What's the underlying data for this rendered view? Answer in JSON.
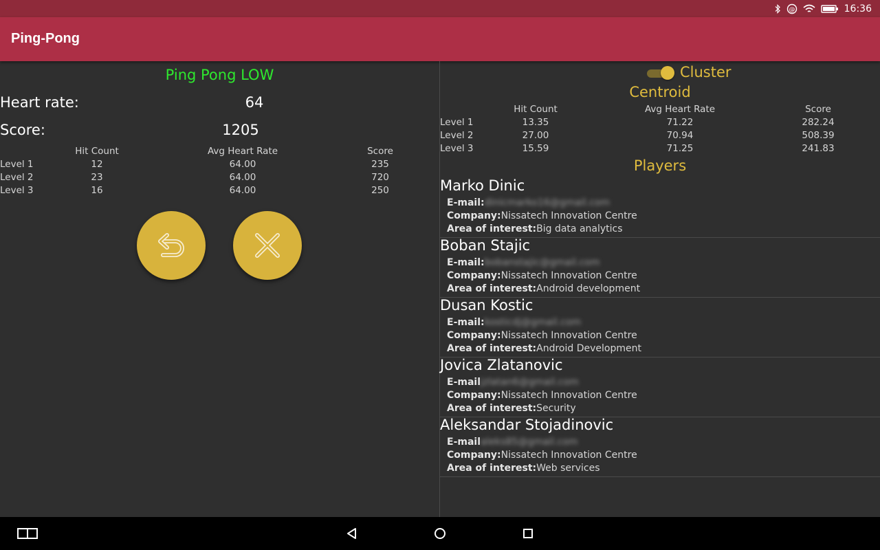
{
  "status_bar": {
    "time": "16:36"
  },
  "app": {
    "title": "Ping-Pong"
  },
  "left": {
    "game_title": "Ping Pong LOW",
    "heart_rate_label": "Heart rate:",
    "heart_rate_value": "64",
    "score_label": "Score:",
    "score_value": "1205",
    "table": {
      "headers": [
        "Hit Count",
        "Avg Heart Rate",
        "Score"
      ],
      "rows": [
        {
          "level": "Level 1",
          "hit_count": "12",
          "avg_heart_rate": "64.00",
          "score": "235"
        },
        {
          "level": "Level 2",
          "hit_count": "23",
          "avg_heart_rate": "64.00",
          "score": "720"
        },
        {
          "level": "Level 3",
          "hit_count": "16",
          "avg_heart_rate": "64.00",
          "score": "250"
        }
      ]
    },
    "buttons": {
      "back_icon": "undo-arrow-icon",
      "close_icon": "close-x-icon"
    }
  },
  "right": {
    "cluster_label": "Cluster",
    "cluster_toggle_on": true,
    "centroid_title": "Centroid",
    "centroid_table": {
      "headers": [
        "Hit Count",
        "Avg Heart Rate",
        "Score"
      ],
      "rows": [
        {
          "level": "Level 1",
          "hit_count": "13.35",
          "avg_heart_rate": "71.22",
          "score": "282.24"
        },
        {
          "level": "Level 2",
          "hit_count": "27.00",
          "avg_heart_rate": "70.94",
          "score": "508.39"
        },
        {
          "level": "Level 3",
          "hit_count": "15.59",
          "avg_heart_rate": "71.25",
          "score": "241.83"
        }
      ]
    },
    "players_title": "Players",
    "labels": {
      "email": "E-mail:",
      "company": "Company:",
      "interest": "Area of interest:"
    },
    "players": [
      {
        "name": "Marko Dinic",
        "email_label": "E-mail:",
        "email": "dinicmarko16@gmail.com",
        "company": "Nissatech Innovation Centre",
        "interest": "Big data analytics"
      },
      {
        "name": "Boban Stajic",
        "email_label": "E-mail:",
        "email": "bobanstajic@gmail.com",
        "company": "Nissatech Innovation Centre",
        "interest": "Android development"
      },
      {
        "name": "Dusan Kostic",
        "email_label": "E-mail:",
        "email": "kosticdj@gmail.com",
        "company": "Nissatech Innovation Centre",
        "interest": "Android Development"
      },
      {
        "name": "Jovica Zlatanovic",
        "email_label": "E-mail",
        "email": "jzlatan6@gmail.com",
        "company": "Nissatech Innovation Centre",
        "interest": "Security"
      },
      {
        "name": "Aleksandar Stojadinovic",
        "email_label": "E-mail",
        "email": "aleks85@gmail.com",
        "company": "Nissatech Innovation Centre",
        "interest": "Web services"
      }
    ]
  },
  "colors": {
    "status_bar": "#8f2a3a",
    "app_bar": "#ad2f46",
    "background": "#2f2f2f",
    "game_title": "#2ee82e",
    "accent_gold": "#e0bc3e",
    "button_gold": "#d8b33c"
  },
  "icons": {
    "bluetooth": "bluetooth-icon",
    "sync": "sync-icon",
    "wifi": "wifi-icon",
    "battery": "battery-icon",
    "recent_apps": "multi-window-icon",
    "back": "back-triangle-icon",
    "home": "home-circle-icon",
    "overview": "overview-square-icon"
  }
}
